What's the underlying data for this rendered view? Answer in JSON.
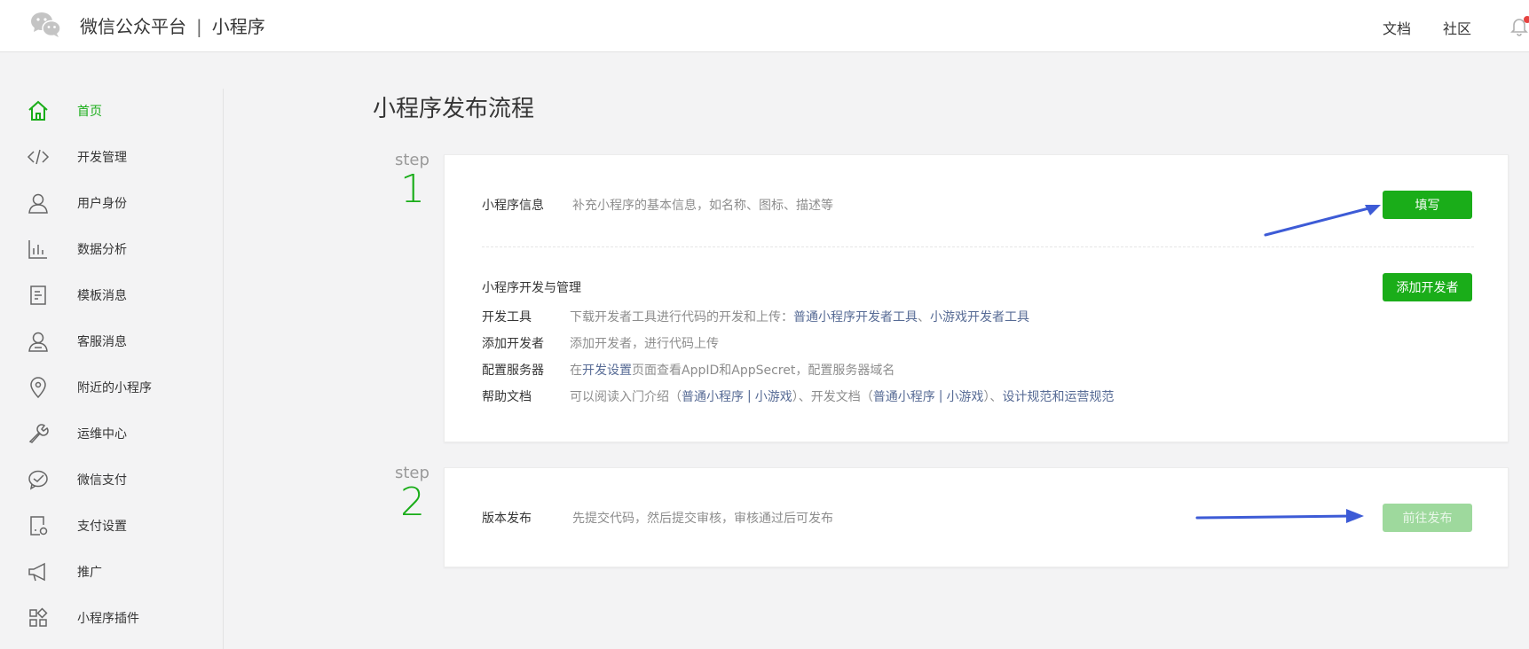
{
  "header": {
    "brand": "微信公众平台",
    "separator": "|",
    "product": "小程序",
    "links": {
      "docs": "文档",
      "community": "社区"
    }
  },
  "sidebar": {
    "items": [
      {
        "label": "首页",
        "icon": "home-icon",
        "active": true
      },
      {
        "label": "开发管理",
        "icon": "code-icon"
      },
      {
        "label": "用户身份",
        "icon": "user-icon"
      },
      {
        "label": "数据分析",
        "icon": "bar-chart-icon"
      },
      {
        "label": "模板消息",
        "icon": "document-icon"
      },
      {
        "label": "客服消息",
        "icon": "customer-service-icon"
      },
      {
        "label": "附近的小程序",
        "icon": "location-pin-icon"
      },
      {
        "label": "运维中心",
        "icon": "wrench-icon"
      },
      {
        "label": "微信支付",
        "icon": "wechat-pay-icon"
      },
      {
        "label": "支付设置",
        "icon": "payment-settings-icon"
      },
      {
        "label": "推广",
        "icon": "megaphone-icon"
      },
      {
        "label": "小程序插件",
        "icon": "plugin-grid-icon"
      }
    ]
  },
  "main": {
    "title": "小程序发布流程",
    "step_word": "step",
    "steps": [
      {
        "number": "1"
      },
      {
        "number": "2"
      }
    ],
    "info": {
      "label": "小程序信息",
      "desc": "补充小程序的基本信息，如名称、图标、描述等",
      "button": "填写"
    },
    "dev": {
      "title": "小程序开发与管理",
      "button": "添加开发者",
      "tools_key": "开发工具",
      "tools_text": "下载开发者工具进行代码的开发和上传：",
      "tools_link1": "普通小程序开发者工具",
      "tools_sep": "、",
      "tools_link2": "小游戏开发者工具",
      "add_key": "添加开发者",
      "add_text": "添加开发者，进行代码上传",
      "server_key": "配置服务器",
      "server_pre": "在",
      "server_link": "开发设置",
      "server_post": "页面查看AppID和AppSecret，配置服务器域名",
      "help_key": "帮助文档",
      "help_pre": "可以阅读入门介绍（",
      "help_link1": "普通小程序",
      "help_bar": "|",
      "help_link2": "小游戏",
      "help_mid": "）、开发文档（",
      "help_link3": "普通小程序",
      "help_link4": "小游戏",
      "help_mid2": "）、",
      "help_link5": "设计规范",
      "help_and": "和",
      "help_link6": "运营规范"
    },
    "release": {
      "label": "版本发布",
      "desc": "先提交代码，然后提交审核，审核通过后可发布",
      "button": "前往发布",
      "button_disabled": true
    }
  },
  "colors": {
    "accent": "#1aad19",
    "link": "#576b95",
    "annotation_arrow": "#3d5bd6"
  }
}
